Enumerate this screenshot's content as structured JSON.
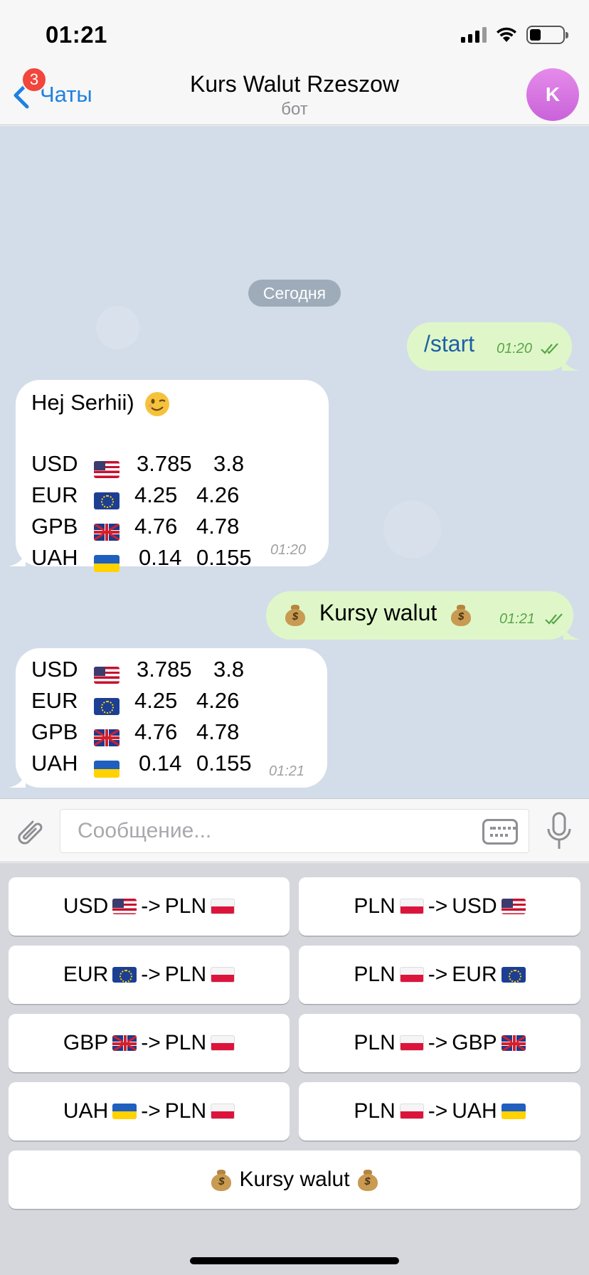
{
  "status": {
    "time": "01:21"
  },
  "header": {
    "back_label": "Чаты",
    "badge": "3",
    "title": "Kurs Walut Rzeszow",
    "subtitle": "бот",
    "avatar_letter": "K"
  },
  "chat": {
    "date_separator": "Сегодня",
    "messages": [
      {
        "dir": "out",
        "text": "/start",
        "time": "01:20"
      },
      {
        "dir": "in",
        "greeting": "Hej Serhii)",
        "greeting_emoji": "wink-emoji",
        "rates": [
          {
            "code": "USD",
            "flag": "flag-us",
            "buy": "3.785",
            "sell": "3.8"
          },
          {
            "code": "EUR",
            "flag": "flag-eu",
            "buy": "4.25",
            "sell": "4.26"
          },
          {
            "code": "GPB",
            "flag": "flag-uk",
            "buy": "4.76",
            "sell": "4.78"
          },
          {
            "code": "UAH",
            "flag": "flag-ua",
            "buy": "0.14",
            "sell": "0.155"
          }
        ],
        "time": "01:20"
      },
      {
        "dir": "out",
        "text": "Kursy walut",
        "time": "01:21"
      },
      {
        "dir": "in",
        "rates": [
          {
            "code": "USD",
            "flag": "flag-us",
            "buy": "3.785",
            "sell": "3.8"
          },
          {
            "code": "EUR",
            "flag": "flag-eu",
            "buy": "4.25",
            "sell": "4.26"
          },
          {
            "code": "GPB",
            "flag": "flag-uk",
            "buy": "4.76",
            "sell": "4.78"
          },
          {
            "code": "UAH",
            "flag": "flag-ua",
            "buy": "0.14",
            "sell": "0.155"
          }
        ],
        "time": "01:21"
      }
    ]
  },
  "composer": {
    "placeholder": "Сообщение..."
  },
  "keyboard": {
    "arrow": "->",
    "buttons": [
      {
        "from": "USD",
        "from_flag": "flag-us",
        "to": "PLN",
        "to_flag": "flag-pl"
      },
      {
        "from": "PLN",
        "from_flag": "flag-pl",
        "to": "USD",
        "to_flag": "flag-us"
      },
      {
        "from": "EUR",
        "from_flag": "flag-eu",
        "to": "PLN",
        "to_flag": "flag-pl"
      },
      {
        "from": "PLN",
        "from_flag": "flag-pl",
        "to": "EUR",
        "to_flag": "flag-eu"
      },
      {
        "from": "GBP",
        "from_flag": "flag-uk",
        "to": "PLN",
        "to_flag": "flag-pl"
      },
      {
        "from": "PLN",
        "from_flag": "flag-pl",
        "to": "GBP",
        "to_flag": "flag-uk"
      },
      {
        "from": "UAH",
        "from_flag": "flag-ua",
        "to": "PLN",
        "to_flag": "flag-pl"
      },
      {
        "from": "PLN",
        "from_flag": "flag-pl",
        "to": "UAH",
        "to_flag": "flag-ua"
      }
    ],
    "kursy_label": "Kursy walut"
  },
  "colors": {
    "accent": "#1f81e0",
    "outgoing_bubble": "#dff7c8",
    "chat_bg": "#d3dde9",
    "badge": "#f2453b"
  }
}
